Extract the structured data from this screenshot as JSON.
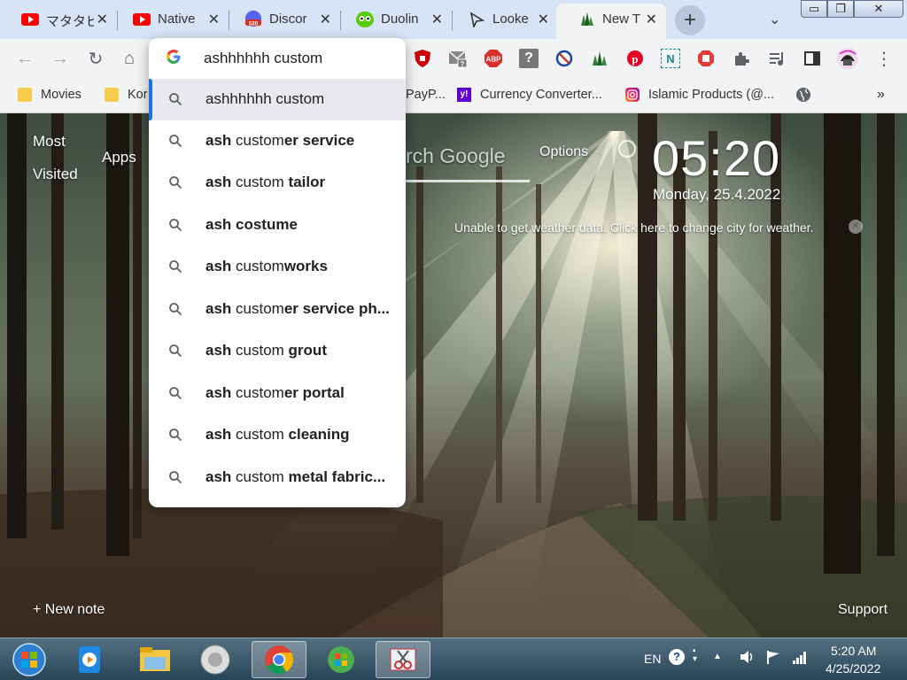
{
  "tabs": [
    {
      "title": "マタタビ",
      "icon": "youtube-icon",
      "close": "✕"
    },
    {
      "title": "Native",
      "icon": "youtube-icon",
      "close": "✕"
    },
    {
      "title": "Discor",
      "icon": "discord-icon",
      "badge": "520",
      "close": "✕"
    },
    {
      "title": "Duolin",
      "icon": "duolingo-icon",
      "close": "✕"
    },
    {
      "title": "Looke",
      "icon": "cursor-icon",
      "close": "✕"
    },
    {
      "title": "New T",
      "icon": "trees-icon",
      "close": "✕"
    }
  ],
  "newtab": "+",
  "tab_dropdown": "⌄",
  "window_controls": {
    "minimize": "▭",
    "restore": "❐",
    "close": "✕"
  },
  "nav": {
    "back": "←",
    "forward": "→",
    "reload": "↻",
    "home": "⌂",
    "menu": "⋮"
  },
  "omnibox": {
    "value": "ashhhhhh custom",
    "g_logo": "G",
    "suggestions": [
      {
        "plain": "ashhhhhh custom",
        "bold": "",
        "tail": ""
      },
      {
        "plain": "",
        "bold": "ash",
        "mid": " custom",
        "tail": "er service"
      },
      {
        "plain": "",
        "bold": "ash",
        "mid": " custom ",
        "tail": "tailor"
      },
      {
        "plain": "",
        "bold": "ash costume",
        "mid": "",
        "tail": ""
      },
      {
        "plain": "",
        "bold": "ash",
        "mid": " custom",
        "tail": "works"
      },
      {
        "plain": "",
        "bold": "ash",
        "mid": " custom",
        "tail": "er service ph..."
      },
      {
        "plain": "",
        "bold": "ash",
        "mid": " custom ",
        "tail": "grout"
      },
      {
        "plain": "",
        "bold": "ash",
        "mid": " custom",
        "tail": "er portal"
      },
      {
        "plain": "",
        "bold": "ash",
        "mid": " custom ",
        "tail": "cleaning"
      },
      {
        "plain": "",
        "bold": "ash",
        "mid": " custom ",
        "tail": "metal fabric..."
      }
    ]
  },
  "extensions": [
    "ublock-icon",
    "gmail-icon",
    "abp-icon",
    "help-icon",
    "block-icon",
    "trees-icon",
    "pinterest-icon",
    "notion-icon",
    "stop-icon",
    "puzzle-icon",
    "media-icon",
    "sidepanel-icon",
    "avatar"
  ],
  "ext_labels": {
    "abp": "ABP",
    "help": "?",
    "notion": "N"
  },
  "bookmarks": [
    {
      "label": "Movies",
      "icon": "folder-icon"
    },
    {
      "label": "Kor",
      "icon": "folder-icon"
    },
    {
      "label": "PayP...",
      "icon": "paypal-icon"
    },
    {
      "label": "Currency Converter...",
      "icon": "yahoo-icon"
    },
    {
      "label": "Islamic Products (@...",
      "icon": "instagram-icon"
    }
  ],
  "bookmarks_more": "»",
  "yahoo_label": "y!",
  "page": {
    "most_visited": "Most",
    "visited": "Visited",
    "apps": "Apps",
    "search_placeholder": "rch Google",
    "options": "Options",
    "clock": "05:20",
    "date": "Monday, 25.4.2022",
    "weather": "Unable to get weather data. Click here to change city for weather.",
    "weather_close": "✕",
    "new_note": "+ New note",
    "support": "Support"
  },
  "taskbar": {
    "lang": "EN",
    "time": "5:20 AM",
    "date": "4/25/2022",
    "help": "?",
    "tray_arrow": "▲"
  },
  "colors": {
    "accent": "#1a73e8",
    "tab_bg": "#d7e4f5",
    "toolbar_bg": "#f1f3f4"
  }
}
